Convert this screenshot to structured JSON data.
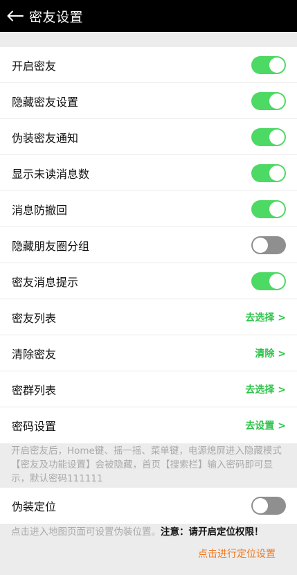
{
  "header": {
    "title": "密友设置"
  },
  "settings_group": {
    "toggles": [
      {
        "label": "开启密友",
        "on": true
      },
      {
        "label": "隐藏密友设置",
        "on": true
      },
      {
        "label": "伪装密友通知",
        "on": true
      },
      {
        "label": "显示未读消息数",
        "on": true
      },
      {
        "label": "消息防撤回",
        "on": true
      },
      {
        "label": "隐藏朋友圈分组",
        "on": false
      },
      {
        "label": "密友消息提示",
        "on": true
      }
    ],
    "links": [
      {
        "label": "密友列表",
        "action": "去选择 >"
      },
      {
        "label": "清除密友",
        "action": "清除 >"
      },
      {
        "label": "密群列表",
        "action": "去选择 >"
      },
      {
        "label": "密码设置",
        "action": "去设置 >"
      }
    ]
  },
  "help_note": "开启密友后，Home键、摇一摇、菜单键，电源熄屏进入隐藏模式【密友及功能设置】会被隐藏，首页【搜索栏】输入密码即可显示，默认密码111111",
  "location": {
    "label": "伪装定位",
    "on": false,
    "note": "点击进入地图页面可设置伪装位置。",
    "warning": "注意：请开启定位权限！",
    "link": "点击进行定位设置"
  },
  "colors": {
    "accent_green": "#4cd964",
    "action_green": "#2cc24a",
    "link_orange": "#f07b22"
  }
}
